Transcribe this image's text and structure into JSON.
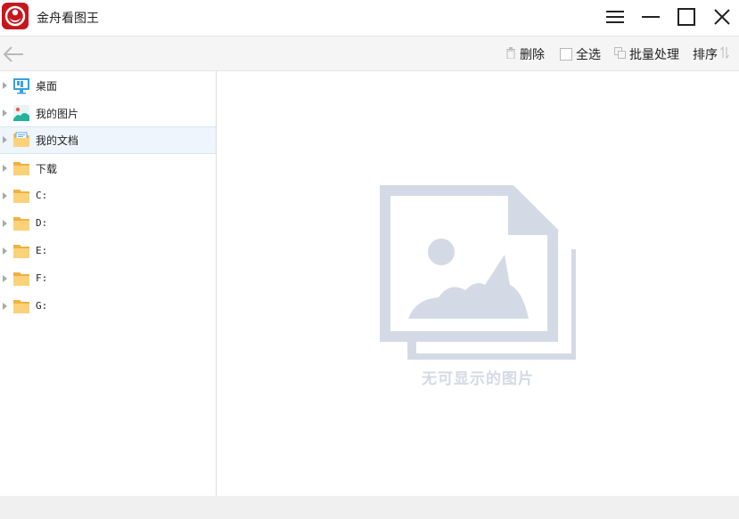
{
  "window": {
    "title": "金舟看图王",
    "controls": [
      "menu-icon",
      "minimize-icon",
      "maximize-icon",
      "close-icon"
    ]
  },
  "toolbar": {
    "back_icon": "arrow-left-icon",
    "delete_label": "删除",
    "select_all_label": "全选",
    "batch_label": "批量处理",
    "sort_label": "排序"
  },
  "sidebar": {
    "items": [
      {
        "label": "桌面",
        "icon": "desktop-icon"
      },
      {
        "label": "我的图片",
        "icon": "pictures-icon"
      },
      {
        "label": "我的文档",
        "icon": "documents-icon",
        "selected": true
      },
      {
        "label": "下载",
        "icon": "folder-icon"
      },
      {
        "label": "C:",
        "icon": "folder-icon"
      },
      {
        "label": "D:",
        "icon": "folder-icon"
      },
      {
        "label": "E:",
        "icon": "folder-icon"
      },
      {
        "label": "F:",
        "icon": "folder-icon"
      },
      {
        "label": "G:",
        "icon": "folder-icon"
      }
    ]
  },
  "main": {
    "empty_text": "无可显示的图片"
  },
  "colors": {
    "brand": "#c8161d",
    "folder": "#f7c15c",
    "selected_bg": "#eef5fc",
    "placeholder": "#d4dae5"
  }
}
